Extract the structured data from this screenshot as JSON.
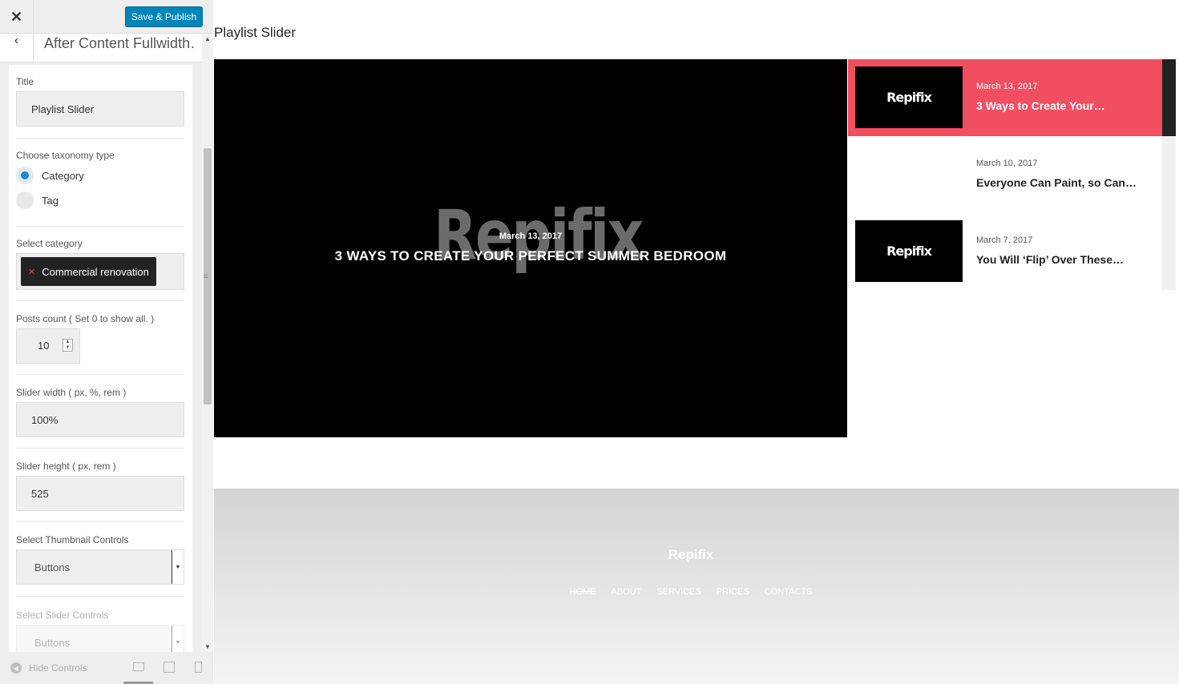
{
  "sidebar": {
    "publish_label": "Save & Publish",
    "header_title": "After Content Fullwidth…",
    "title_label": "Title",
    "title_value": "Playlist Slider",
    "taxonomy_label": "Choose taxonomy type",
    "taxonomy_options": [
      "Category",
      "Tag"
    ],
    "taxonomy_selected": "Category",
    "category_label": "Select category",
    "category_chip": "Commercial renovation",
    "posts_label": "Posts count ( Set 0 to show all. )",
    "posts_value": "10",
    "width_label": "Slider width ( px, %, rem )",
    "width_value": "100%",
    "height_label": "Slider height ( px, rem )",
    "height_value": "525",
    "thumb_controls_label": "Select Thumbnail Controls",
    "thumb_controls_value": "Buttons",
    "slider_controls_label": "Select Slider Controls",
    "slider_controls_value": "Buttons",
    "hide_controls": "Hide Controls"
  },
  "preview": {
    "title": "Playlist Slider",
    "main_slide": {
      "watermark": "Repifix",
      "date": "March 13, 2017",
      "title": "3 WAYS TO CREATE YOUR PERFECT SUMMER BEDROOM"
    },
    "playlist": [
      {
        "thumb": "Repifix",
        "date": "March 13, 2017",
        "title": "3 Ways to Create Your…"
      },
      {
        "thumb": "",
        "date": "March 10, 2017",
        "title": "Everyone Can Paint, so Can…"
      },
      {
        "thumb": "Repifix",
        "date": "March 7, 2017",
        "title": "You Will ‘Flip’ Over These…"
      }
    ],
    "footer": {
      "brand": "Repifix",
      "nav": [
        "HOME",
        "ABOUT",
        "SERVICES",
        "PRICES",
        "CONTACTS"
      ]
    }
  },
  "colors": {
    "accent": "#f24e61",
    "publish": "#0085ba",
    "radio": "#1e8cbe"
  }
}
